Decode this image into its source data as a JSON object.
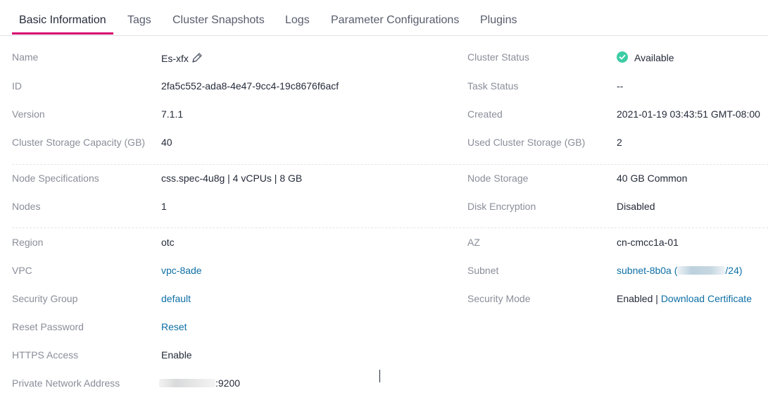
{
  "tabs": [
    {
      "label": "Basic Information",
      "active": true
    },
    {
      "label": "Tags"
    },
    {
      "label": "Cluster Snapshots"
    },
    {
      "label": "Logs"
    },
    {
      "label": "Parameter Configurations"
    },
    {
      "label": "Plugins"
    }
  ],
  "left": {
    "name": {
      "label": "Name",
      "value": "Es-xfx"
    },
    "id": {
      "label": "ID",
      "value": "2fa5c552-ada8-4e47-9cc4-19c8676f6acf"
    },
    "version": {
      "label": "Version",
      "value": "7.1.1"
    },
    "capacity": {
      "label": "Cluster Storage Capacity (GB)",
      "value": "40"
    },
    "node_spec": {
      "label": "Node Specifications",
      "value": "css.spec-4u8g | 4 vCPUs | 8 GB"
    },
    "nodes": {
      "label": "Nodes",
      "value": "1"
    },
    "region": {
      "label": "Region",
      "value": "otc"
    },
    "vpc": {
      "label": "VPC",
      "value": "vpc-8ade"
    },
    "security_group": {
      "label": "Security Group",
      "value": "default"
    },
    "reset_password": {
      "label": "Reset Password",
      "value": "Reset"
    },
    "https": {
      "label": "HTTPS Access",
      "value": "Enable"
    },
    "private_address": {
      "label": "Private Network Address",
      "value_suffix": ":9200"
    }
  },
  "right": {
    "cluster_status": {
      "label": "Cluster Status",
      "value": "Available",
      "color": "#3dcca6"
    },
    "task_status": {
      "label": "Task Status",
      "value": "--"
    },
    "created": {
      "label": "Created",
      "value": "2021-01-19 03:43:51 GMT-08:00"
    },
    "used_storage": {
      "label": "Used Cluster Storage (GB)",
      "value": "2"
    },
    "node_storage": {
      "label": "Node Storage",
      "value": "40 GB Common"
    },
    "disk_encryption": {
      "label": "Disk Encryption",
      "value": "Disabled"
    },
    "az": {
      "label": "AZ",
      "value": "cn-cmcc1a-01"
    },
    "subnet": {
      "label": "Subnet",
      "value_prefix": "subnet-8b0a (",
      "value_suffix": "/24)"
    },
    "security_mode": {
      "label": "Security Mode",
      "value": "Enabled",
      "separator": " | ",
      "link": "Download Certificate"
    }
  },
  "colors": {
    "accent": "#d6006f",
    "link": "#0e6fa6",
    "label": "#8a8e99",
    "text": "#252b3a"
  },
  "icons": [
    "pencil-icon",
    "check-circle-icon"
  ]
}
